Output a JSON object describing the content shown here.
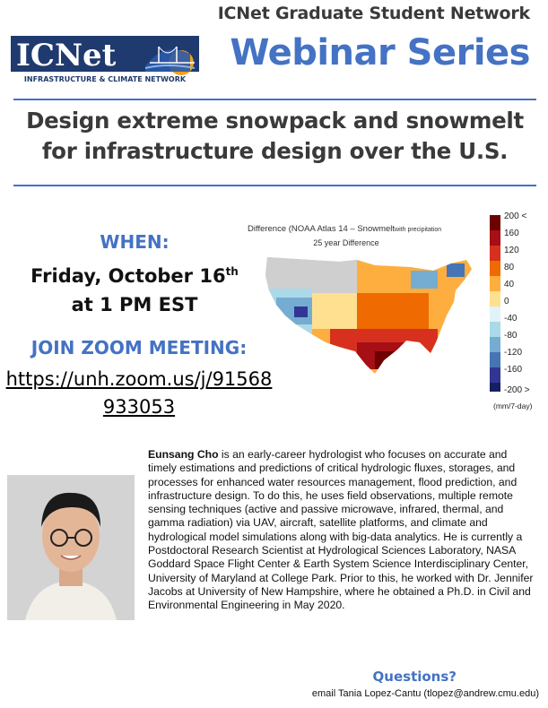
{
  "header": {
    "logo_wordmark": "ICNet",
    "logo_tagline": "INFRASTRUCTURE & CLIMATE NETWORK",
    "network_title": "ICNet Graduate Student Network",
    "series_title": "Webinar Series"
  },
  "talk": {
    "title_line1": "Design extreme snowpack and snowmelt",
    "title_line2": "for infrastructure design over the U.S."
  },
  "event": {
    "when_label": "WHEN:",
    "date_prefix": "Friday, October 16",
    "date_suffix": "th",
    "time": "at 1 PM EST",
    "zoom_label": "JOIN ZOOM MEETING:",
    "zoom_url": "https://unh.zoom.us/j/91568933053"
  },
  "figure": {
    "title": "Difference (NOAA Atlas 14 – Snowmelt",
    "title_small": "with precipitation",
    "subtitle": "25 year Difference",
    "colorbar_labels": [
      "200 <",
      "160",
      "120",
      "80",
      "40",
      "0",
      "-40",
      "-80",
      "-120",
      "-160",
      "-200 >"
    ],
    "colorbar_unit": "(mm/7-day)",
    "colors": [
      "#6e0000",
      "#a50f15",
      "#d7301f",
      "#ef6a00",
      "#fdae3f",
      "#fee090",
      "#e0f3f8",
      "#abd9e9",
      "#74add1",
      "#4575b4",
      "#313695",
      "#162060"
    ]
  },
  "speaker": {
    "name": "Eunsang Cho",
    "bio": " is an early-career hydrologist who focuses on accurate and timely estimations and predictions of critical hydrologic fluxes, storages, and processes for enhanced water resources management, flood prediction, and infrastructure design. To do this, he uses field observations, multiple remote sensing techniques (active and passive microwave, infrared, thermal, and gamma radiation) via UAV, aircraft, satellite platforms, and climate and hydrological model simulations along with big-data analytics. He is currently a Postdoctoral Research Scientist at Hydrological Sciences Laboratory, NASA Goddard Space Flight Center & Earth System Science Interdisciplinary Center, University of Maryland at College Park. Prior to this, he worked with Dr. Jennifer Jacobs at University of New Hampshire, where he obtained a Ph.D. in Civil and Environmental Engineering in May 2020."
  },
  "contact": {
    "questions_label": "Questions?",
    "email_line": "email Tania Lopez-Cantu (tlopez@andrew.cmu.edu)"
  },
  "theme": {
    "accent": "#4472c4",
    "heading": "#3a3a3a"
  }
}
